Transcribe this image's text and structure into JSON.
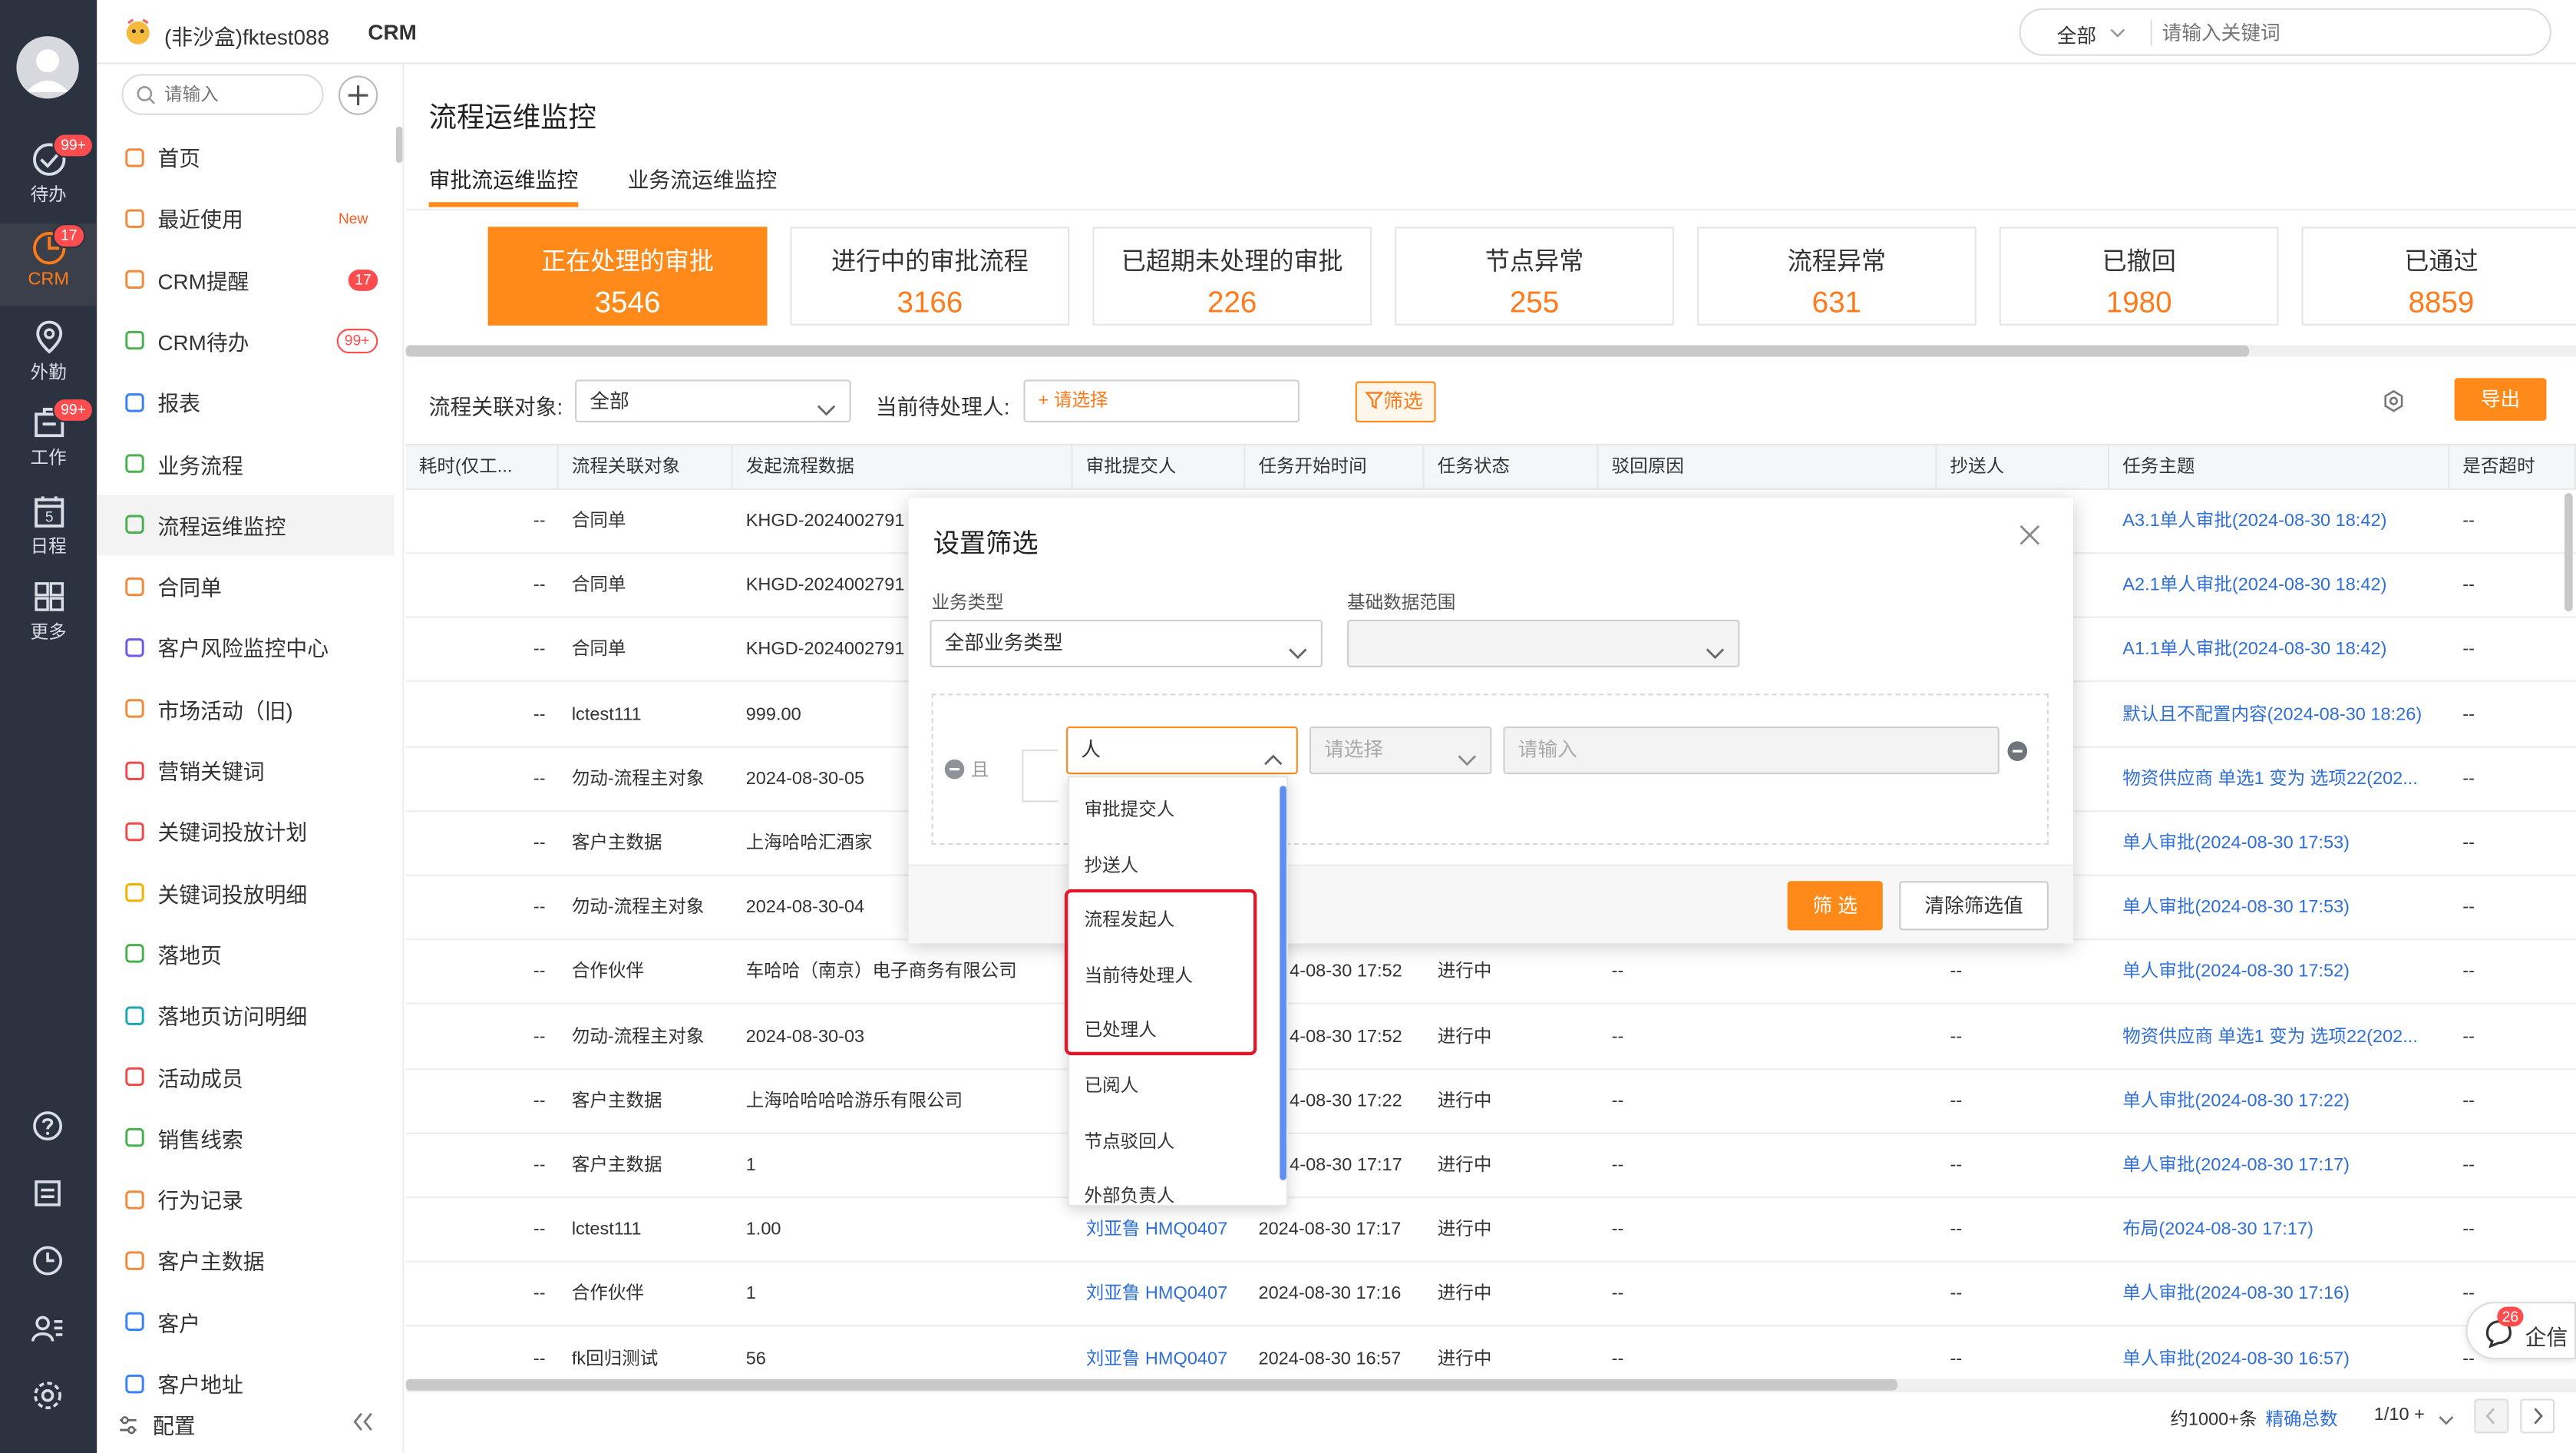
{
  "app": {
    "tenant": "(非沙盒)fktest088",
    "module": "CRM"
  },
  "search": {
    "scope": "全部",
    "placeholder": "请输入关键词"
  },
  "rail": [
    {
      "label": "待办",
      "badge": "99+"
    },
    {
      "label": "CRM",
      "badge": "17"
    },
    {
      "label": "外勤",
      "badge": ""
    },
    {
      "label": "工作",
      "badge": "99+"
    },
    {
      "label": "日程",
      "badge": ""
    },
    {
      "label": "更多",
      "badge": ""
    }
  ],
  "rail_day": "5",
  "menu": {
    "search_placeholder": "请输入",
    "items": [
      {
        "label": "首页",
        "badge": ""
      },
      {
        "label": "最近使用",
        "tag": "New"
      },
      {
        "label": "CRM提醒",
        "badge": "17"
      },
      {
        "label": "CRM待办",
        "badge": "99+"
      },
      {
        "label": "报表"
      },
      {
        "label": "业务流程"
      },
      {
        "label": "流程运维监控"
      },
      {
        "label": "合同单"
      },
      {
        "label": "客户风险监控中心"
      },
      {
        "label": "市场活动（旧)"
      },
      {
        "label": "营销关键词"
      },
      {
        "label": "关键词投放计划"
      },
      {
        "label": "关键词投放明细"
      },
      {
        "label": "落地页"
      },
      {
        "label": "落地页访问明细"
      },
      {
        "label": "活动成员"
      },
      {
        "label": "销售线索"
      },
      {
        "label": "行为记录"
      },
      {
        "label": "客户主数据"
      },
      {
        "label": "客户"
      },
      {
        "label": "客户地址"
      }
    ],
    "footer": "配置"
  },
  "page": {
    "title": "流程运维监控",
    "tabs": [
      "审批流运维监控",
      "业务流运维监控"
    ]
  },
  "stats": [
    {
      "label": "正在处理的审批",
      "value": "3546"
    },
    {
      "label": "进行中的审批流程",
      "value": "3166"
    },
    {
      "label": "已超期未处理的审批",
      "value": "226"
    },
    {
      "label": "节点异常",
      "value": "255"
    },
    {
      "label": "流程异常",
      "value": "631"
    },
    {
      "label": "已撤回",
      "value": "1980"
    },
    {
      "label": "已通过",
      "value": "8859"
    }
  ],
  "filterbar": {
    "object_label": "流程关联对象:",
    "object_value": "全部",
    "handler_label": "当前待处理人:",
    "handler_placeholder": "+ 请选择",
    "filter_btn": "筛选",
    "export_btn": "导出"
  },
  "table": {
    "headers": [
      "耗时(仅工...",
      "流程关联对象",
      "发起流程数据",
      "审批提交人",
      "任务开始时间",
      "任务状态",
      "驳回原因",
      "抄送人",
      "任务主题",
      "是否超时"
    ],
    "rows": [
      [
        "--",
        "合同单",
        "KHGD-2024002791",
        "",
        "",
        "",
        "",
        "",
        "A3.1单人审批(2024-08-30 18:42)",
        "--"
      ],
      [
        "--",
        "合同单",
        "KHGD-2024002791",
        "",
        "",
        "",
        "",
        "",
        "A2.1单人审批(2024-08-30 18:42)",
        "--"
      ],
      [
        "--",
        "合同单",
        "KHGD-2024002791",
        "",
        "",
        "",
        "",
        "",
        "A1.1单人审批(2024-08-30 18:42)",
        "--"
      ],
      [
        "--",
        "lctest111",
        "999.00",
        "",
        "",
        "",
        "",
        "",
        "默认且不配置内容(2024-08-30 18:26)",
        "--"
      ],
      [
        "--",
        "勿动-流程主对象",
        "2024-08-30-05",
        "",
        "",
        "",
        "",
        "",
        "物资供应商 单选1 变为  选项22(202...",
        "--"
      ],
      [
        "--",
        "客户主数据",
        "上海哈哈汇酒家",
        "",
        "",
        "",
        "",
        "",
        "单人审批(2024-08-30 17:53)",
        "--"
      ],
      [
        "--",
        "勿动-流程主对象",
        "2024-08-30-04",
        "",
        "",
        "",
        "",
        "",
        "单人审批(2024-08-30 17:53)",
        "--"
      ],
      [
        "--",
        "合作伙伴",
        "车哈哈（南京）电子商务有限公司",
        "",
        "4-08-30 17:52",
        "进行中",
        "--",
        "--",
        "单人审批(2024-08-30 17:52)",
        "--"
      ],
      [
        "--",
        "勿动-流程主对象",
        "2024-08-30-03",
        "",
        "4-08-30 17:52",
        "进行中",
        "--",
        "--",
        "物资供应商 单选1 变为  选项22(202...",
        "--"
      ],
      [
        "--",
        "客户主数据",
        "上海哈哈哈哈游乐有限公司",
        "",
        "4-08-30 17:22",
        "进行中",
        "--",
        "--",
        "单人审批(2024-08-30 17:22)",
        "--"
      ],
      [
        "--",
        "客户主数据",
        "1",
        "",
        "4-08-30 17:17",
        "进行中",
        "--",
        "--",
        "单人审批(2024-08-30 17:17)",
        "--"
      ],
      [
        "--",
        "lctest111",
        "1.00",
        "刘亚鲁 HMQ0407",
        "2024-08-30 17:17",
        "进行中",
        "--",
        "--",
        "布局(2024-08-30 17:17)",
        "--"
      ],
      [
        "--",
        "合作伙伴",
        "1",
        "刘亚鲁 HMQ0407",
        "2024-08-30 17:16",
        "进行中",
        "--",
        "--",
        "单人审批(2024-08-30 17:16)",
        "--"
      ],
      [
        "--",
        "fk回归测试",
        "56",
        "刘亚鲁 HMQ0407",
        "2024-08-30 16:57",
        "进行中",
        "--",
        "--",
        "单人审批(2024-08-30 16:57)",
        "--"
      ]
    ]
  },
  "modal": {
    "title": "设置筛选",
    "biz_type_label": "业务类型",
    "biz_type_value": "全部业务类型",
    "data_range_label": "基础数据范围",
    "logic": "且",
    "field_value": "人",
    "op_placeholder": "请选择",
    "value_placeholder": "请输入",
    "confirm_btn": "筛 选",
    "clear_btn": "清除筛选值"
  },
  "dropdown": [
    "审批提交人",
    "抄送人",
    "流程发起人",
    "当前待处理人",
    "已处理人",
    "已阅人",
    "节点驳回人",
    "外部负责人"
  ],
  "pagination": {
    "total": "约1000+条",
    "exact": "精确总数",
    "page": "1/10 +"
  },
  "chat": {
    "label": "企信",
    "badge": "26"
  },
  "colors": {
    "accent": "#ff8a1a",
    "link": "#2f6fd8",
    "highlight": "#e0162b"
  }
}
